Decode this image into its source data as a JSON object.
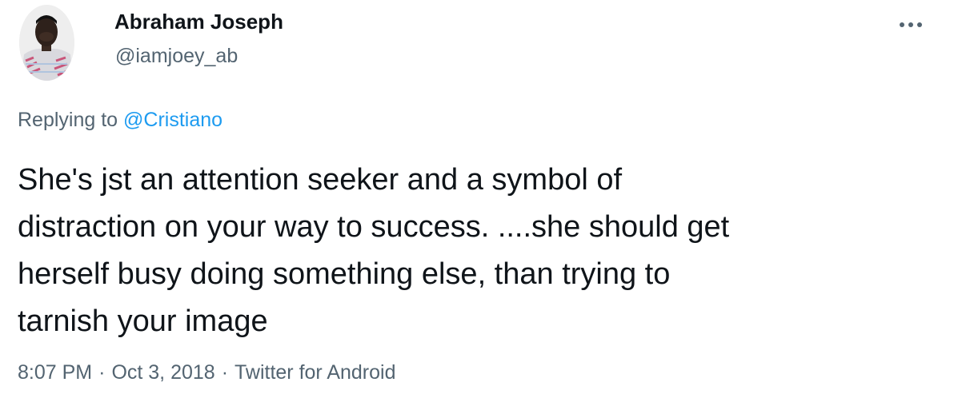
{
  "author": {
    "display_name": "Abraham Joseph",
    "handle": "@iamjoey_ab",
    "avatar_icon": "profile-photo"
  },
  "more_icon": "more-horizontal-icon",
  "reply": {
    "prefix": "Replying to",
    "mention": "@Cristiano"
  },
  "tweet": {
    "text_lines": [
      "She's jst an attention seeker and a symbol of",
      "distraction on your way to success. ....she should get",
      "herself busy doing something else, than trying to",
      "tarnish your image"
    ]
  },
  "meta": {
    "time": "8:07 PM",
    "separator": "·",
    "date": "Oct 3, 2018",
    "source": "Twitter for Android"
  },
  "colors": {
    "text": "#0f1419",
    "secondary": "#536471",
    "link": "#1d9bf0",
    "background": "#ffffff"
  }
}
